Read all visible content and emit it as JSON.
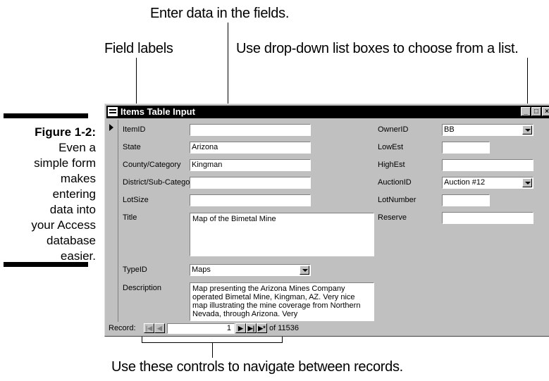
{
  "callouts": {
    "enter_data": "Enter data in the fields.",
    "field_labels": "Field labels",
    "dropdown": "Use drop-down list boxes to choose from a list.",
    "navigate": "Use these controls to navigate between records."
  },
  "caption": {
    "figure": "Figure 1-2:",
    "lines": [
      "Even a",
      "simple form",
      "makes",
      "entering",
      "data into",
      "your Access",
      "database",
      "easier."
    ]
  },
  "window": {
    "title": "Items Table Input",
    "buttons": [
      "_",
      "□",
      "×"
    ]
  },
  "form": {
    "left": [
      {
        "label": "ItemID",
        "value": ""
      },
      {
        "label": "State",
        "value": "Arizona"
      },
      {
        "label": "County/Category",
        "value": "Kingman"
      },
      {
        "label": "District/Sub-Category",
        "value": ""
      },
      {
        "label": "LotSize",
        "value": ""
      },
      {
        "label": "Title",
        "value": "Map of the Bimetal Mine"
      },
      {
        "label": "TypeID",
        "value": "Maps"
      },
      {
        "label": "Description",
        "value": "Map presenting the Arizona Mines Company operated Bimetal Mine, Kingman, AZ.  Very nice map illustrating the mine coverage from Northern Nevada, through Arizona.  Very"
      }
    ],
    "right": [
      {
        "label": "OwnerID",
        "value": "BB"
      },
      {
        "label": "LowEst",
        "value": ""
      },
      {
        "label": "HighEst",
        "value": ""
      },
      {
        "label": "AuctionID",
        "value": "Auction #12"
      },
      {
        "label": "LotNumber",
        "value": ""
      },
      {
        "label": "Reserve",
        "value": ""
      }
    ]
  },
  "navigation": {
    "label": "Record:",
    "current": "1",
    "of_text": "of  11536",
    "first": "|◀",
    "prev": "◀",
    "next": "▶",
    "last": "▶|",
    "new": "▶*"
  }
}
